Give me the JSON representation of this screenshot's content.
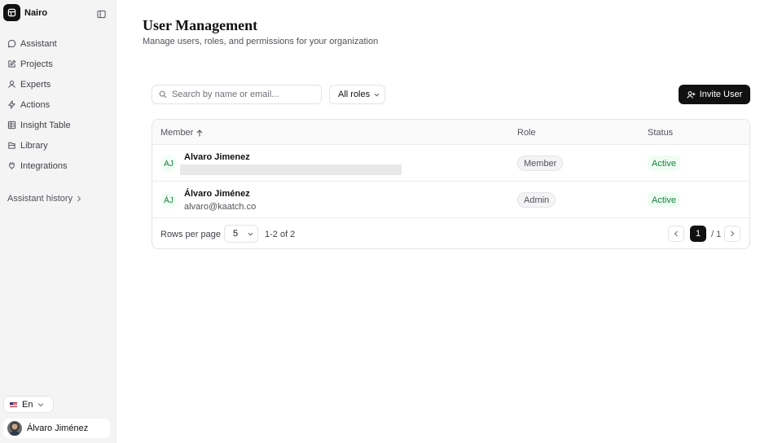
{
  "brand": {
    "name": "Nairo"
  },
  "sidebar": {
    "items": [
      {
        "label": "Assistant",
        "icon": "chat-bubble-icon"
      },
      {
        "label": "Projects",
        "icon": "edit-square-icon"
      },
      {
        "label": "Experts",
        "icon": "person-icon"
      },
      {
        "label": "Actions",
        "icon": "bolt-icon"
      },
      {
        "label": "Insight Table",
        "icon": "table-icon"
      },
      {
        "label": "Library",
        "icon": "library-icon"
      },
      {
        "label": "Integrations",
        "icon": "plug-icon"
      }
    ],
    "history_label": "Assistant history",
    "language": "En",
    "user_name": "Álvaro Jiménez"
  },
  "page": {
    "title": "User Management",
    "subtitle": "Manage users, roles, and permissions for your organization"
  },
  "toolbar": {
    "search_placeholder": "Search by name or email...",
    "role_filter": "All roles",
    "invite_label": "Invite User"
  },
  "table": {
    "headers": {
      "member": "Member",
      "role": "Role",
      "status": "Status"
    },
    "rows": [
      {
        "initials": "AJ",
        "name": "Alvaro Jimenez",
        "email": "",
        "role": "Member",
        "status": "Active"
      },
      {
        "initials": "ÁJ",
        "name": "Álvaro Jiménez",
        "email": "alvaro@kaatch.co",
        "role": "Admin",
        "status": "Active"
      }
    ]
  },
  "pagination": {
    "rows_label": "Rows per page",
    "rows_value": "5",
    "range": "1-2 of 2",
    "current": "1",
    "total": "/ 1"
  },
  "colors": {
    "primary": "#111111",
    "status_active": "#15803d",
    "status_bg": "#f0fdf4",
    "sidebar_bg": "#f4f4f5"
  }
}
